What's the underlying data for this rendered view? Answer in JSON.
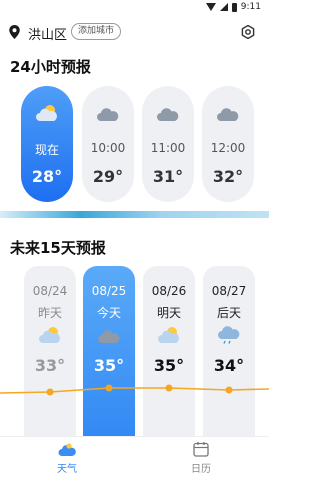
{
  "status_bar": {
    "time": "9:11"
  },
  "header": {
    "city": "洪山区",
    "add_city_label": "添加城市"
  },
  "hourly": {
    "title": "24小时预报",
    "items": [
      {
        "time": "现在",
        "temp": "28°",
        "icon": "sun-cloud-icon",
        "active": true
      },
      {
        "time": "10:00",
        "temp": "29°",
        "icon": "cloud-icon",
        "active": false
      },
      {
        "time": "11:00",
        "temp": "31°",
        "icon": "cloud-icon",
        "active": false
      },
      {
        "time": "12:00",
        "temp": "32°",
        "icon": "cloud-icon",
        "active": false
      }
    ]
  },
  "daily": {
    "title": "未来15天预报",
    "items": [
      {
        "date": "08/24",
        "label": "昨天",
        "temp": "33°",
        "high": 33,
        "icon": "sun-cloud-icon",
        "state": "past"
      },
      {
        "date": "08/25",
        "label": "今天",
        "temp": "35°",
        "high": 35,
        "icon": "cloud-icon",
        "state": "today"
      },
      {
        "date": "08/26",
        "label": "明天",
        "temp": "35°",
        "high": 35,
        "icon": "sun-cloud-icon",
        "state": "future"
      },
      {
        "date": "08/27",
        "label": "后天",
        "temp": "34°",
        "high": 34,
        "icon": "rain-cloud-icon",
        "state": "future"
      }
    ]
  },
  "bottom_nav": {
    "weather_label": "天气",
    "calendar_label": "日历"
  },
  "colors": {
    "accent": "#2f86f3",
    "trend_line": "#f5a623",
    "card_bg": "#eef0f4"
  }
}
